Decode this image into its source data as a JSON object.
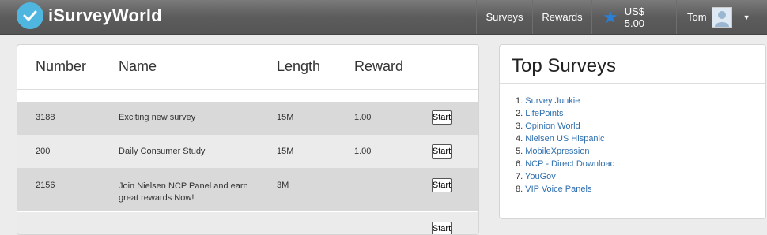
{
  "brand": {
    "name": "iSurveyWorld"
  },
  "nav": {
    "surveys": "Surveys",
    "rewards": "Rewards",
    "balance": "US$ 5.00",
    "user": "Tom"
  },
  "table": {
    "headers": [
      "Number",
      "Name",
      "Length",
      "Reward"
    ],
    "start_label": "Start",
    "rows": [
      {
        "number": "3188",
        "name": "Exciting new survey",
        "length": "15M",
        "reward": "1.00"
      },
      {
        "number": "200",
        "name": "Daily Consumer Study",
        "length": "15M",
        "reward": "1.00"
      },
      {
        "number": "2156",
        "name": "Join Nielsen NCP Panel and earn great rewards Now!",
        "length": "3M",
        "reward": ""
      }
    ]
  },
  "top_surveys": {
    "title": "Top Surveys",
    "items": [
      "Survey Junkie",
      "LifePoints",
      "Opinion World",
      "Nielsen US Hispanic",
      "MobileXpression",
      "NCP - Direct Download",
      "YouGov",
      "VIP Voice Panels"
    ]
  },
  "colors": {
    "accent": "#4fb6e0",
    "link": "#2f6fae",
    "row_dark": "#d9d9d9",
    "row_light": "#ebebeb"
  }
}
